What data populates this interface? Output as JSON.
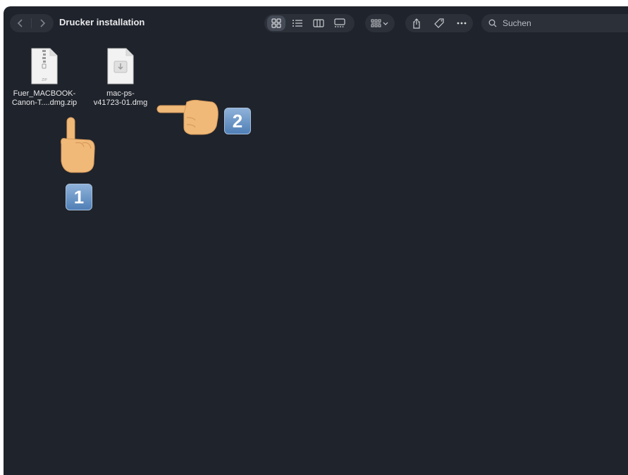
{
  "toolbar": {
    "back_icon": "chevron-left-icon",
    "forward_icon": "chevron-right-icon",
    "title": "Drucker installation",
    "views": [
      "icon-view-icon",
      "list-view-icon",
      "column-view-icon",
      "gallery-view-icon"
    ],
    "active_view": "icon-view-icon",
    "group_icon": "group-by-icon",
    "actions": [
      "share-icon",
      "tag-icon",
      "more-icon"
    ],
    "search": {
      "placeholder": "Suchen",
      "value": ""
    }
  },
  "files": [
    {
      "line1": "Fuer_MACBOOK-",
      "line2": "Canon-T....dmg.zip",
      "type": "zip",
      "type_label": "ZIP"
    },
    {
      "line1": "mac-ps-",
      "line2": "v41723-01.dmg",
      "type": "dmg"
    }
  ],
  "annotations": [
    {
      "label": "1",
      "pointer": "pointing-up-hand"
    },
    {
      "label": "2",
      "pointer": "pointing-left-hand"
    }
  ],
  "colors": {
    "window_bg": "#1f232b",
    "control_bg": "#2b3039",
    "badge": "#5a87bd",
    "skin": "#f0b978"
  }
}
